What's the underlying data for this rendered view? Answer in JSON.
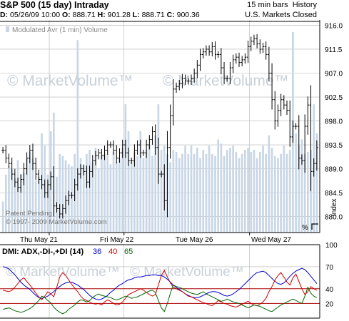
{
  "header": {
    "title": "S&P 500  (15 day) Intraday",
    "interval": "15 min bars",
    "history_label": "History",
    "market_status": "U.S. Markets Closed",
    "d_label": "D:",
    "d_value": "05/26/09 10:00",
    "o_label": "O:",
    "o_value": "888.71",
    "h_label": "H:",
    "h_value": "901.28",
    "l_label": "L:",
    "l_value": "888.71",
    "c_label": "C:",
    "c_value": "900.36"
  },
  "price_panel": {
    "volume_legend": "Modulated Avr (1 min) Volume",
    "watermark": "© MarketVolume™",
    "patent": "Patent Pending",
    "copyright": "© 1997- 2009 MarketVolume.com",
    "axis_title": "Index",
    "percent_label": "%",
    "x_labels": [
      "Thu May 21",
      "Fri May 22",
      "Tue May 26",
      "Wed May 27"
    ],
    "y_ticks": [
      "916.0",
      "911.5",
      "907.0",
      "902.5",
      "898.0",
      "893.5",
      "889.0",
      "884.5",
      "880.0"
    ]
  },
  "dmi_panel": {
    "title": "DMI: ADX,-DI-,+DI  (14)",
    "params": [
      "36",
      "40",
      "65"
    ],
    "param_colors": [
      "#0000cc",
      "#cc0000",
      "#006600"
    ],
    "watermark": "© MarketVolume™",
    "y_ticks": [
      "100",
      "70",
      "40",
      "20"
    ]
  },
  "colors": {
    "price_bar": "#000000",
    "volume_bar": "#c8d6e6",
    "grid": "#b4b4b4",
    "threshold_line": "#aa0000",
    "adx": "#0000cc",
    "minus_di": "#cc0000",
    "plus_di": "#006600",
    "watermark": "#c8d0d8"
  },
  "chart_data": [
    {
      "type": "bar",
      "subtype": "ohlc",
      "title": "S&P 500  (15 day) Intraday",
      "ylabel": "Index",
      "ylim": [
        877,
        917
      ],
      "x_labels": [
        "Thu May 21",
        "Fri May 22",
        "Tue May 26",
        "Wed May 27"
      ],
      "series": [
        {
          "close": [
            892.5,
            891.0,
            890.0,
            888.0,
            886.5,
            885.5,
            887.0,
            889.0,
            891.0,
            892.5,
            890.0,
            888.0,
            887.0,
            886.0,
            884.5,
            886.0,
            887.5,
            882.0,
            881.5,
            880.5,
            881.5,
            883.0,
            884.0,
            884.0,
            886.0,
            888.0,
            889.0,
            888.5,
            886.5,
            888.5,
            890.5,
            891.5,
            892.0,
            891.5,
            892.5,
            893.5,
            893.5,
            892.5,
            891.0,
            892.0,
            893.5,
            892.0,
            890.5,
            890.5,
            892.5,
            893.5,
            892.0,
            892.0,
            893.5,
            894.5,
            896.0,
            893.0,
            888.0,
            888.0,
            883.0,
            893.0,
            899.0,
            904.0,
            904.5,
            905.0,
            906.0,
            905.5,
            905.5,
            906.0,
            907.0,
            908.5,
            910.5,
            911.0,
            911.5,
            911.0,
            912.0,
            910.5,
            910.5,
            908.0,
            906.0,
            906.0,
            908.0,
            909.5,
            910.0,
            909.0,
            909.5,
            910.0,
            912.0,
            913.0,
            913.5,
            912.5,
            911.5,
            912.0,
            910.5,
            907.0,
            902.0,
            898.0,
            900.0,
            902.0,
            901.0,
            900.0,
            895.0,
            897.0,
            897.0,
            891.0,
            890.5,
            897.0,
            901.0,
            888.5,
            890.0,
            893.0
          ]
        }
      ]
    },
    {
      "type": "bar",
      "title": "Modulated Avr (1 min) Volume",
      "ylim": [
        0,
        1
      ],
      "values": [
        0.15,
        0.28,
        0.32,
        0.31,
        0.26,
        0.35,
        0.28,
        0.29,
        0.36,
        0.39,
        0.36,
        0.25,
        0.27,
        0.48,
        0.42,
        0.28,
        0.49,
        0.58,
        0.27,
        0.38,
        0.37,
        0.35,
        0.33,
        0.32,
        0.38,
        0.93,
        0.36,
        0.33,
        0.38,
        0.4,
        0.34,
        0.41,
        0.31,
        0.37,
        0.38,
        0.38,
        0.33,
        0.39,
        0.34,
        0.36,
        0.41,
        0.62,
        0.49,
        0.34,
        0.39,
        0.37,
        0.49,
        0.36,
        0.4,
        0.42,
        0.37,
        0.47,
        0.62,
        0.4,
        0.42,
        0.38,
        0.34,
        0.4,
        0.39,
        0.36,
        0.38,
        0.42,
        0.38,
        0.42,
        0.38,
        0.41,
        0.36,
        0.4,
        0.38,
        0.42,
        0.38,
        0.37,
        0.45,
        0.43,
        0.37,
        0.4,
        0.41,
        0.42,
        0.39,
        0.36,
        0.38,
        0.4,
        0.41,
        0.39,
        0.4,
        0.36,
        0.39,
        0.42,
        0.38,
        0.47,
        0.41,
        0.37,
        0.36,
        0.38,
        0.42,
        0.38,
        0.4,
        0.97,
        0.48,
        0.42,
        0.45,
        0.38,
        0.39,
        0.4,
        0.62,
        0.48
      ]
    },
    {
      "type": "line",
      "title": "DMI: ADX,-DI-,+DI  (14)",
      "ylim": [
        0,
        100
      ],
      "yticks": [
        100,
        70,
        40,
        20
      ],
      "reference_lines": [
        40,
        20
      ],
      "series": [
        {
          "name": "ADX",
          "values": [
            70,
            69,
            67,
            63,
            59,
            54,
            49,
            45,
            42,
            39,
            35,
            31,
            28,
            27,
            28,
            30,
            33,
            36,
            40,
            43,
            46,
            48,
            49,
            49,
            47,
            45,
            42,
            39,
            35,
            31,
            28,
            26,
            25,
            26,
            28,
            31,
            35,
            38,
            42,
            45,
            47,
            50,
            52,
            53,
            55,
            56,
            56,
            57,
            58,
            58,
            59,
            59,
            58,
            58,
            56,
            53,
            49,
            45,
            42,
            39,
            36,
            33,
            31,
            29,
            28,
            28,
            29,
            31,
            33,
            35,
            36,
            36,
            35,
            33,
            31,
            30,
            31,
            33,
            36,
            39,
            43,
            47,
            51,
            55,
            59,
            62,
            63,
            64,
            62,
            58,
            54,
            50,
            47,
            46,
            48,
            52,
            57,
            61,
            64,
            66,
            68,
            66,
            62,
            57,
            52,
            47
          ]
        },
        {
          "name": "-DI-",
          "values": [
            38,
            37,
            36,
            38,
            42,
            47,
            52,
            55,
            50,
            45,
            40,
            34,
            29,
            25,
            30,
            36,
            33,
            29,
            42,
            56,
            62,
            58,
            52,
            46,
            41,
            36,
            30,
            26,
            24,
            22,
            20,
            19,
            20,
            18,
            22,
            25,
            23,
            20,
            18,
            19,
            22,
            27,
            32,
            34,
            36,
            38,
            40,
            38,
            35,
            32,
            30,
            32,
            45,
            58,
            65,
            56,
            48,
            42,
            40,
            38,
            36,
            33,
            30,
            29,
            27,
            25,
            23,
            21,
            20,
            18,
            17,
            20,
            24,
            22,
            20,
            19,
            17,
            16,
            15,
            17,
            19,
            21,
            23,
            20,
            18,
            17,
            19,
            22,
            27,
            36,
            43,
            52,
            58,
            62,
            56,
            49,
            45,
            55,
            60,
            50,
            40,
            32,
            36,
            43,
            40,
            38
          ]
        },
        {
          "name": "+DI",
          "values": [
            12,
            13,
            14,
            12,
            10,
            9,
            8,
            9,
            11,
            13,
            16,
            20,
            24,
            30,
            28,
            24,
            21,
            15,
            11,
            8,
            6,
            8,
            12,
            15,
            18,
            22,
            25,
            24,
            22,
            24,
            28,
            31,
            33,
            31,
            30,
            29,
            28,
            26,
            25,
            26,
            28,
            30,
            29,
            27,
            28,
            29,
            31,
            33,
            35,
            37,
            38,
            35,
            24,
            14,
            9,
            20,
            34,
            45,
            43,
            42,
            40,
            38,
            36,
            34,
            33,
            32,
            34,
            36,
            33,
            31,
            29,
            27,
            25,
            23,
            24,
            26,
            24,
            22,
            21,
            20,
            18,
            16,
            14,
            16,
            18,
            17,
            16,
            14,
            12,
            10,
            9,
            12,
            15,
            18,
            20,
            22,
            24,
            26,
            24,
            22,
            20,
            30,
            42,
            34,
            30,
            28
          ]
        }
      ]
    }
  ]
}
